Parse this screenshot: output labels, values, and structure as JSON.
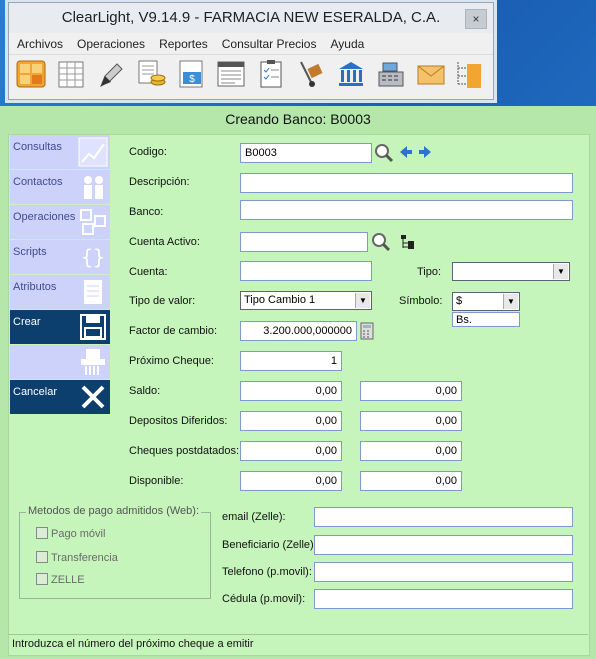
{
  "app": {
    "title": "ClearLight, V9.14.9 - FARMACIA NEW ESERALDA, C.A.",
    "close": "×",
    "menu": [
      "Archivos",
      "Operaciones",
      "Reportes",
      "Consultar Precios",
      "Ayuda"
    ],
    "toolbar_icons": [
      "grid-app-icon",
      "spreadsheet-icon",
      "pen-icon",
      "documents-coins-icon",
      "dollar-doc-icon",
      "report-icon",
      "checklist-icon",
      "handtruck-icon",
      "bank-icon",
      "cash-register-icon",
      "mail-icon",
      "folders-tree-icon"
    ]
  },
  "dialog": {
    "title": "Creando Banco: B0003",
    "sidebar": [
      {
        "label": "Consultas",
        "icon": "chart-icon"
      },
      {
        "label": "Contactos",
        "icon": "people-icon"
      },
      {
        "label": "Operaciones",
        "icon": "operations-icon"
      },
      {
        "label": "Scripts",
        "icon": "scripts-icon"
      },
      {
        "label": "Atributos",
        "icon": "attributes-icon"
      },
      {
        "label": "Crear",
        "icon": "save-icon"
      },
      {
        "label": "",
        "icon": "shredder-icon"
      },
      {
        "label": "Cancelar",
        "icon": "cancel-x-icon"
      }
    ],
    "fields": {
      "codigo": {
        "label": "Codigo:",
        "value": "B0003"
      },
      "descripcion": {
        "label": "Descripción:",
        "value": ""
      },
      "banco": {
        "label": "Banco:",
        "value": ""
      },
      "cuenta_activo": {
        "label": "Cuenta Activo:",
        "value": ""
      },
      "cuenta": {
        "label": "Cuenta:",
        "value": ""
      },
      "tipo": {
        "label": "Tipo:",
        "value": ""
      },
      "tipo_valor": {
        "label": "Tipo de valor:",
        "value": "Tipo Cambio 1"
      },
      "simbolo": {
        "label": "Símbolo:",
        "value": "$",
        "option": "Bs."
      },
      "factor_cambio": {
        "label": "Factor de cambio:",
        "value": "3.200.000,000000"
      },
      "proximo_cheque": {
        "label": "Próximo Cheque:",
        "value": "1"
      },
      "saldo": {
        "label": "Saldo:",
        "values": [
          "0,00",
          "0,00"
        ]
      },
      "depositos_diferidos": {
        "label": "Depositos Diferidos:",
        "values": [
          "0,00",
          "0,00"
        ]
      },
      "cheques_postdatados": {
        "label": "Cheques postdatados:",
        "values": [
          "0,00",
          "0,00"
        ]
      },
      "disponible": {
        "label": "Disponible:",
        "values": [
          "0,00",
          "0,00"
        ]
      }
    },
    "metodos": {
      "title": "Metodos de pago admitidos (Web):",
      "options": [
        "Pago móvil",
        "Transferencia",
        "ZELLE"
      ]
    },
    "web_fields": {
      "email": {
        "label": "email (Zelle):",
        "value": ""
      },
      "beneficiario": {
        "label": "Beneficiario (Zelle):",
        "value": ""
      },
      "telefono": {
        "label": "Telefono (p.movil):",
        "value": ""
      },
      "cedula": {
        "label": "Cédula (p.movil):",
        "value": ""
      }
    },
    "status": "Introduzca el número del próximo cheque a emitir"
  }
}
